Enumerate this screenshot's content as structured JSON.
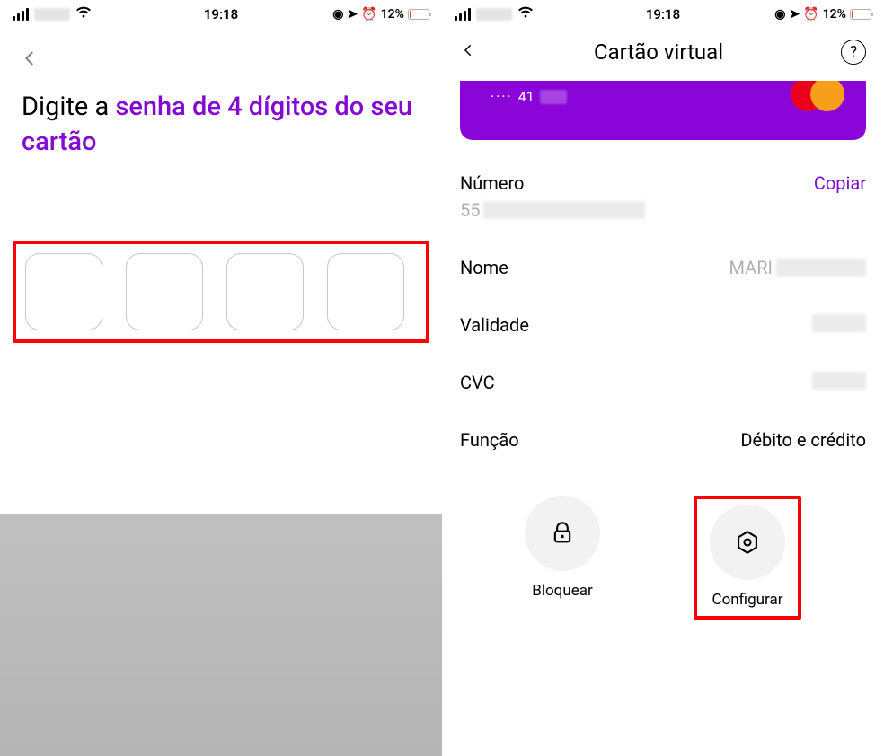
{
  "status": {
    "time": "19:18",
    "battery_pct": "12%",
    "nav_icon": "◉",
    "location_icon": "➤",
    "alarm_icon": "⏰"
  },
  "screen_left": {
    "title_normal_1": "Digite a ",
    "title_accent": "senha de 4 dígitos do seu cartão",
    "pin_count": 4
  },
  "screen_right": {
    "header_title": "Cartão virtual",
    "help_label": "?",
    "card_prefix_dots": "····",
    "card_last2": "41",
    "rows": {
      "numero_label": "Número",
      "numero_prefix": "55",
      "copiar": "Copiar",
      "nome_label": "Nome",
      "nome_value": "MARI",
      "validade_label": "Validade",
      "cvc_label": "CVC",
      "funcao_label": "Função",
      "funcao_value": "Débito e crédito"
    },
    "actions": {
      "block_label": "Bloquear",
      "config_label": "Configurar"
    }
  }
}
